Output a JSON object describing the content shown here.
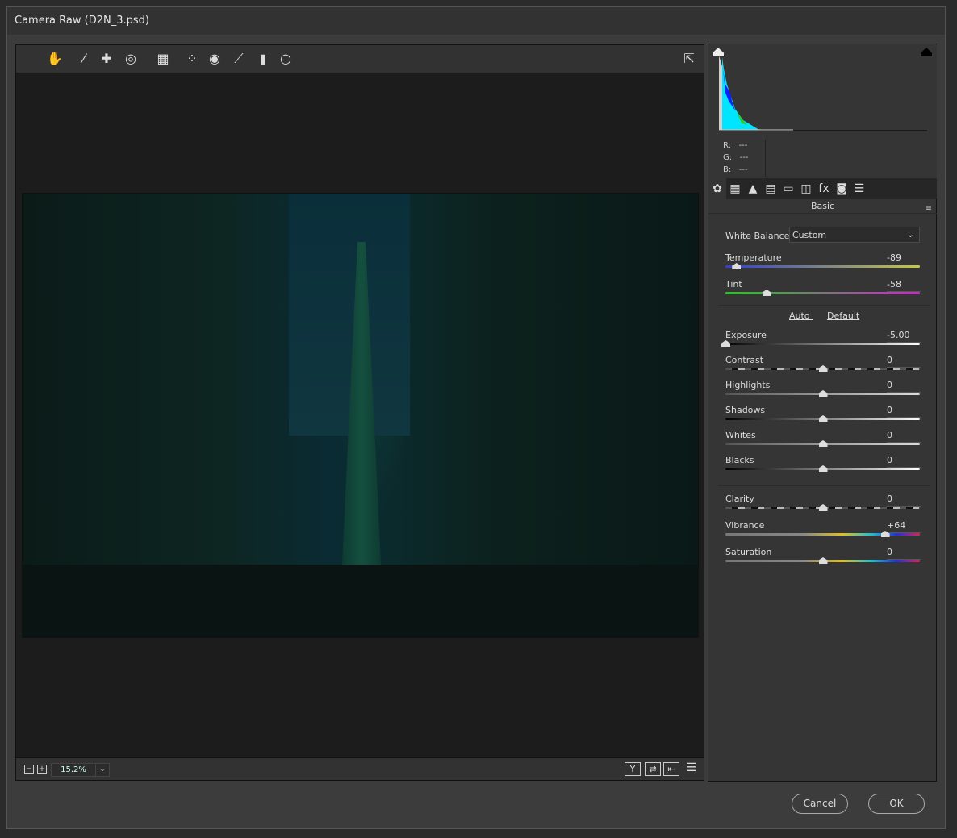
{
  "window": {
    "title": "Camera Raw (D2N_3.psd)"
  },
  "toolbar": {
    "tools": [
      {
        "name": "hand-tool-icon",
        "glyph": "✋"
      },
      {
        "name": "white-balance-tool-icon",
        "glyph": "⁄"
      },
      {
        "name": "color-sampler-tool-icon",
        "glyph": "✚"
      },
      {
        "name": "targeted-adjustment-tool-icon",
        "glyph": "◎"
      },
      {
        "name": "transform-tool-icon",
        "glyph": "▦"
      },
      {
        "name": "spot-removal-tool-icon",
        "glyph": "⁘"
      },
      {
        "name": "red-eye-tool-icon",
        "glyph": "◉"
      },
      {
        "name": "adjustment-brush-icon",
        "glyph": "⟋"
      },
      {
        "name": "graduated-filter-icon",
        "glyph": "▮"
      },
      {
        "name": "radial-filter-icon",
        "glyph": "○"
      }
    ],
    "open_prefs_glyph": "⇱"
  },
  "footer": {
    "zoom": "15.2%",
    "zoom_arrow": "⌄",
    "minus": "−",
    "plus": "+",
    "view_y": "Y",
    "swap": "⇄",
    "copy": "⇤",
    "settings": "☰"
  },
  "histogram": {
    "r_label": "R:",
    "g_label": "G:",
    "b_label": "B:",
    "r": "---",
    "g": "---",
    "b": "---"
  },
  "panel_tabs": [
    "✿",
    "▦",
    "▲",
    "▤",
    "▭",
    "◫",
    "fx",
    "◙",
    "☰"
  ],
  "panel": {
    "section": "Basic",
    "menu_glyph": "≡",
    "wb_label": "White Balance:",
    "wb_value": "Custom",
    "wb_arrow": "⌄",
    "auto": "Auto",
    "default": "Default"
  },
  "sliders": [
    {
      "label": "Temperature",
      "value": "-89",
      "num": -89,
      "min": -100,
      "max": 100,
      "track": "temp"
    },
    {
      "label": "Tint",
      "value": "-58",
      "num": -58,
      "min": -100,
      "max": 100,
      "track": "tint"
    },
    {
      "label": "Exposure",
      "value": "-5.00",
      "num": -5,
      "min": -5,
      "max": 5,
      "track": "exp"
    },
    {
      "label": "Contrast",
      "value": "0",
      "num": 0,
      "min": -100,
      "max": 100,
      "track": "con"
    },
    {
      "label": "Highlights",
      "value": "0",
      "num": 0,
      "min": -100,
      "max": 100,
      "track": "gray"
    },
    {
      "label": "Shadows",
      "value": "0",
      "num": 0,
      "min": -100,
      "max": 100,
      "track": "exp"
    },
    {
      "label": "Whites",
      "value": "0",
      "num": 0,
      "min": -100,
      "max": 100,
      "track": "gray"
    },
    {
      "label": "Blacks",
      "value": "0",
      "num": 0,
      "min": -100,
      "max": 100,
      "track": "exp"
    },
    {
      "label": "Clarity",
      "value": "0",
      "num": 0,
      "min": -100,
      "max": 100,
      "track": "con"
    },
    {
      "label": "Vibrance",
      "value": "+64",
      "num": 64,
      "min": -100,
      "max": 100,
      "track": "sat"
    },
    {
      "label": "Saturation",
      "value": "0",
      "num": 0,
      "min": -100,
      "max": 100,
      "track": "sat"
    }
  ],
  "buttons": {
    "cancel": "Cancel",
    "ok": "OK"
  }
}
